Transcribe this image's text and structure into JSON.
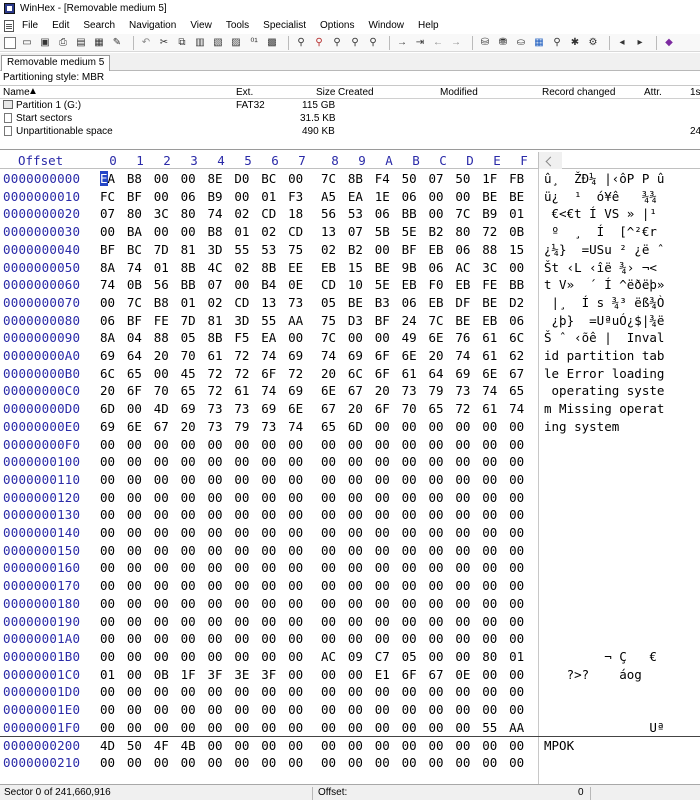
{
  "window": {
    "title": "WinHex - [Removable medium 5]"
  },
  "menu": [
    "File",
    "Edit",
    "Search",
    "Navigation",
    "View",
    "Tools",
    "Specialist",
    "Options",
    "Window",
    "Help"
  ],
  "tab": {
    "label": "Removable medium 5"
  },
  "partitioning_style": "Partitioning style: MBR",
  "partition_table": {
    "headers": {
      "name": "Name",
      "ext": "Ext.",
      "size": "Size",
      "created": "Created",
      "modified": "Modified",
      "record_changed": "Record changed",
      "attr": "Attr.",
      "first_sector": "1s"
    },
    "rows": [
      {
        "name": "Partition 1 (G:)",
        "ext": "FAT32",
        "size": "115 GB",
        "tail": ""
      },
      {
        "name": "Start sectors",
        "ext": "",
        "size": "31.5 KB",
        "tail": ""
      },
      {
        "name": "Unpartitionable space",
        "ext": "",
        "size": "490 KB",
        "tail": "24"
      }
    ]
  },
  "hex": {
    "header": {
      "offset": "Offset",
      "cols": [
        "0",
        "1",
        "2",
        "3",
        "4",
        "5",
        "6",
        "7",
        "8",
        "9",
        "A",
        "B",
        "C",
        "D",
        "E",
        "F"
      ]
    },
    "rows": [
      {
        "off": "0000000000",
        "bytes": "EA B8 00 00 8E D0 BC 00 7C 8B F4 50 07 50 1F FB",
        "txt": "û¸  ŽÐ¼ |‹ôP P û"
      },
      {
        "off": "0000000010",
        "bytes": "FC BF 00 06 B9 00 01 F3 A5 EA 1E 06 00 00 BE BE",
        "txt": "ü¿  ¹  ó¥ê   ¾¾"
      },
      {
        "off": "0000000020",
        "bytes": "07 80 3C 80 74 02 CD 18 56 53 06 BB 00 7C B9 01",
        "txt": " €<€t Í VS » |¹"
      },
      {
        "off": "0000000030",
        "bytes": "00 BA 00 00 B8 01 02 CD 13 07 5B 5E B2 80 72 0B",
        "txt": " º  ¸  Í  [^²€r"
      },
      {
        "off": "0000000040",
        "bytes": "BF BC 7D 81 3D 55 53 75 02 B2 00 BF EB 06 88 15",
        "txt": "¿¼}  =USu ² ¿ë ˆ"
      },
      {
        "off": "0000000050",
        "bytes": "8A 74 01 8B 4C 02 8B EE EB 15 BE 9B 06 AC 3C 00",
        "txt": "Št ‹L ‹îë ¾› ¬<"
      },
      {
        "off": "0000000060",
        "bytes": "74 0B 56 BB 07 00 B4 0E CD 10 5E EB F0 EB FE BB",
        "txt": "t V»  ´ Í ^ëðëþ»"
      },
      {
        "off": "0000000070",
        "bytes": "00 7C B8 01 02 CD 13 73 05 BE B3 06 EB DF BE D2",
        "txt": " |¸  Í s ¾³ ëß¾Ò"
      },
      {
        "off": "0000000080",
        "bytes": "06 BF FE 7D 81 3D 55 AA 75 D3 BF 24 7C BE EB 06",
        "txt": " ¿þ}  =UªuÓ¿$|¾ë"
      },
      {
        "off": "0000000090",
        "bytes": "8A 04 88 05 8B F5 EA 00 7C 00 00 49 6E 76 61 6C",
        "txt": "Š ˆ ‹õê |  Inval"
      },
      {
        "off": "00000000A0",
        "bytes": "69 64 20 70 61 72 74 69 74 69 6F 6E 20 74 61 62",
        "txt": "id partition tab"
      },
      {
        "off": "00000000B0",
        "bytes": "6C 65 00 45 72 72 6F 72 20 6C 6F 61 64 69 6E 67",
        "txt": "le Error loading"
      },
      {
        "off": "00000000C0",
        "bytes": "20 6F 70 65 72 61 74 69 6E 67 20 73 79 73 74 65",
        "txt": " operating syste"
      },
      {
        "off": "00000000D0",
        "bytes": "6D 00 4D 69 73 73 69 6E 67 20 6F 70 65 72 61 74",
        "txt": "m Missing operat"
      },
      {
        "off": "00000000E0",
        "bytes": "69 6E 67 20 73 79 73 74 65 6D 00 00 00 00 00 00",
        "txt": "ing system"
      },
      {
        "off": "00000000F0",
        "bytes": "00 00 00 00 00 00 00 00 00 00 00 00 00 00 00 00",
        "txt": ""
      },
      {
        "off": "0000000100",
        "bytes": "00 00 00 00 00 00 00 00 00 00 00 00 00 00 00 00",
        "txt": ""
      },
      {
        "off": "0000000110",
        "bytes": "00 00 00 00 00 00 00 00 00 00 00 00 00 00 00 00",
        "txt": ""
      },
      {
        "off": "0000000120",
        "bytes": "00 00 00 00 00 00 00 00 00 00 00 00 00 00 00 00",
        "txt": ""
      },
      {
        "off": "0000000130",
        "bytes": "00 00 00 00 00 00 00 00 00 00 00 00 00 00 00 00",
        "txt": ""
      },
      {
        "off": "0000000140",
        "bytes": "00 00 00 00 00 00 00 00 00 00 00 00 00 00 00 00",
        "txt": ""
      },
      {
        "off": "0000000150",
        "bytes": "00 00 00 00 00 00 00 00 00 00 00 00 00 00 00 00",
        "txt": ""
      },
      {
        "off": "0000000160",
        "bytes": "00 00 00 00 00 00 00 00 00 00 00 00 00 00 00 00",
        "txt": ""
      },
      {
        "off": "0000000170",
        "bytes": "00 00 00 00 00 00 00 00 00 00 00 00 00 00 00 00",
        "txt": ""
      },
      {
        "off": "0000000180",
        "bytes": "00 00 00 00 00 00 00 00 00 00 00 00 00 00 00 00",
        "txt": ""
      },
      {
        "off": "0000000190",
        "bytes": "00 00 00 00 00 00 00 00 00 00 00 00 00 00 00 00",
        "txt": ""
      },
      {
        "off": "00000001A0",
        "bytes": "00 00 00 00 00 00 00 00 00 00 00 00 00 00 00 00",
        "txt": ""
      },
      {
        "off": "00000001B0",
        "bytes": "00 00 00 00 00 00 00 00 AC 09 C7 05 00 00 80 01",
        "txt": "        ¬ Ç   €"
      },
      {
        "off": "00000001C0",
        "bytes": "01 00 0B 1F 3F 3E 3F 00 00 00 E1 6F 67 0E 00 00",
        "txt": "   ?>?    áog"
      },
      {
        "off": "00000001D0",
        "bytes": "00 00 00 00 00 00 00 00 00 00 00 00 00 00 00 00",
        "txt": ""
      },
      {
        "off": "00000001E0",
        "bytes": "00 00 00 00 00 00 00 00 00 00 00 00 00 00 00 00",
        "txt": ""
      },
      {
        "off": "00000001F0",
        "bytes": "00 00 00 00 00 00 00 00 00 00 00 00 00 00 55 AA",
        "txt": "              Uª"
      },
      {
        "off": "0000000200",
        "bytes": "4D 50 4F 4B 00 00 00 00 00 00 00 00 00 00 00 00",
        "txt": "MPOK"
      },
      {
        "off": "0000000210",
        "bytes": "00 00 00 00 00 00 00 00 00 00 00 00 00 00 00 00",
        "txt": ""
      }
    ]
  },
  "status": {
    "sector": "Sector 0 of 241,660,916",
    "offset_label": "Offset:",
    "value": "0"
  },
  "colors": {
    "offset_blue": "#2a2aa8",
    "cursor_blue": "#2446c6"
  }
}
